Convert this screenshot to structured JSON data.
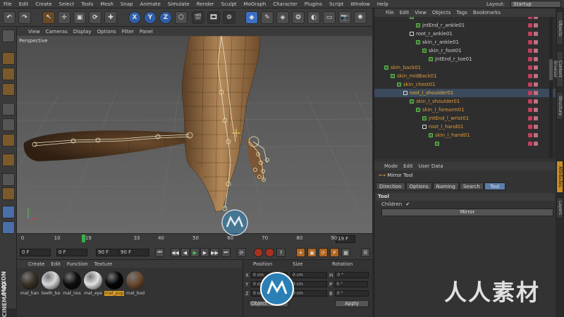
{
  "menubar": {
    "items": [
      "File",
      "Edit",
      "Create",
      "Select",
      "Tools",
      "Mesh",
      "Snap",
      "Animate",
      "Simulate",
      "Render",
      "Sculpt",
      "MoGraph",
      "Character",
      "Plugins",
      "Script",
      "Window",
      "Help"
    ],
    "layout_label": "Layout:",
    "layout_value": "Startup"
  },
  "viewport": {
    "menu": [
      "View",
      "Cameras",
      "Display",
      "Options",
      "Filter",
      "Panel"
    ],
    "label": "Perspective"
  },
  "timeline": {
    "ticks": [
      "0",
      "10",
      "19",
      "33",
      "40",
      "50",
      "60",
      "70",
      "80",
      "90"
    ],
    "current_frame": "19 F",
    "playhead_frame": 19,
    "max_frame": 90
  },
  "transport": {
    "start": "0 F",
    "preview_start": "0 F",
    "preview_end": "90 F",
    "end": "90 F"
  },
  "materials": {
    "menu": [
      "Create",
      "Edit",
      "Function",
      "Texture"
    ],
    "items": [
      {
        "label": "mat_han",
        "color": "#3b3026"
      },
      {
        "label": "teeth_ba",
        "color": "#d8d8d8"
      },
      {
        "label": "mat_nos",
        "color": "#0e0e0e"
      },
      {
        "label": "mat_eye",
        "color": "#e2e2e2"
      },
      {
        "label": "mat_pup",
        "color": "#050505"
      },
      {
        "label": "mat_bod",
        "color": "#6a4a2e"
      }
    ],
    "selected_index": 4
  },
  "coordinates": {
    "headers": [
      "Position",
      "Size",
      "Rotation"
    ],
    "rows": [
      {
        "axis": "X",
        "pos": "0 cm",
        "size": "0 cm",
        "rot_axis": "H",
        "rot": "0 °"
      },
      {
        "axis": "Y",
        "pos": "0 cm",
        "size": "0 cm",
        "rot_axis": "P",
        "rot": "0 °"
      },
      {
        "axis": "Z",
        "pos": "0 cm",
        "size": "0 cm",
        "rot_axis": "B",
        "rot": "0 °"
      }
    ],
    "mode": "Object",
    "apply_label": "Apply"
  },
  "brand": {
    "maxon": "MAXON",
    "cinema": "CINEMA 4D"
  },
  "object_manager": {
    "menu": [
      "File",
      "Edit",
      "View",
      "Objects",
      "Tags",
      "Bookmarks"
    ],
    "rows": [
      {
        "label": "",
        "indent": 4,
        "color": "#cfcfcf",
        "icon": "joint"
      },
      {
        "label": "jntEnd_r_ankle01",
        "indent": 5,
        "color": "#cfcfcf",
        "icon": "joint"
      },
      {
        "label": "root_r_ankle01",
        "indent": 4,
        "color": "#cfcfcf",
        "icon": "null"
      },
      {
        "label": "skin_r_ankle01",
        "indent": 5,
        "color": "#cfcfcf",
        "icon": "joint"
      },
      {
        "label": "skin_r_foot01",
        "indent": 6,
        "color": "#cfcfcf",
        "icon": "joint"
      },
      {
        "label": "jntEnd_r_toe01",
        "indent": 7,
        "color": "#cfcfcf",
        "icon": "joint"
      },
      {
        "label": "skin_back01",
        "indent": 0,
        "color": "#e09a3a",
        "icon": "joint"
      },
      {
        "label": "skin_midBack01",
        "indent": 1,
        "color": "#e09a3a",
        "icon": "joint"
      },
      {
        "label": "skin_chest01",
        "indent": 2,
        "color": "#e09a3a",
        "icon": "joint"
      },
      {
        "label": "root_l_shoulder01",
        "indent": 3,
        "color": "#f0b030",
        "icon": "null"
      },
      {
        "label": "skin_l_shoulder01",
        "indent": 4,
        "color": "#e09a3a",
        "icon": "joint"
      },
      {
        "label": "skin_l_forearm01",
        "indent": 5,
        "color": "#e09a3a",
        "icon": "joint"
      },
      {
        "label": "jntEnd_l_wrist01",
        "indent": 6,
        "color": "#e09a3a",
        "icon": "joint"
      },
      {
        "label": "root_l_hand01",
        "indent": 6,
        "color": "#e09a3a",
        "icon": "null"
      },
      {
        "label": "skin_l_hand01",
        "indent": 7,
        "color": "#e09a3a",
        "icon": "joint"
      },
      {
        "label": "",
        "indent": 8,
        "color": "#e09a3a",
        "icon": "joint"
      }
    ],
    "highlighted_index": 9
  },
  "attributes": {
    "menu": [
      "Mode",
      "Edit",
      "User Data"
    ],
    "title": "Mirror Tool",
    "tabs": [
      "Direction",
      "Options",
      "Naming",
      "Search",
      "Tool"
    ],
    "active_tab": 4,
    "section": "Tool",
    "children_label": "Children",
    "children_check": "✔",
    "mirror_label": "Mirror"
  },
  "side_tabs": [
    "Objects",
    "Content Browser",
    "Structure",
    "Attributes",
    "Layers"
  ],
  "active_side_tab": 3,
  "watermark": {
    "text": "人人素材"
  },
  "colors": {
    "accent_orange": "#e09a3a",
    "playhead_green": "#35b04a",
    "active_tab_blue": "#5b7cad"
  }
}
